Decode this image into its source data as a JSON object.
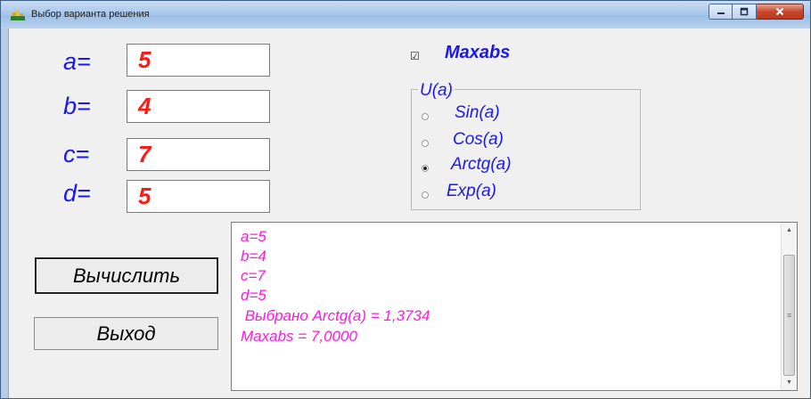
{
  "window": {
    "title": "Выбор варианта решения",
    "minimize_icon": "minimize-icon",
    "maximize_icon": "maximize-icon",
    "close_icon": "close-icon"
  },
  "inputs": [
    {
      "label": "a=",
      "value": "5"
    },
    {
      "label": "b=",
      "value": "4"
    },
    {
      "label": "c=",
      "value": "7"
    },
    {
      "label": "d=",
      "value": "5"
    }
  ],
  "maxabs": {
    "label": "Maxabs",
    "checked": true,
    "check_glyph": "☑"
  },
  "group": {
    "title": "U(a)",
    "options": [
      {
        "label": "Sin(a)",
        "selected": false
      },
      {
        "label": "Cos(a)",
        "selected": false
      },
      {
        "label": "Arctg(a)",
        "selected": true
      },
      {
        "label": "Exp(a)",
        "selected": false
      }
    ]
  },
  "buttons": {
    "compute": "Вычислить",
    "exit": "Выход"
  },
  "output": {
    "lines": [
      "a=5",
      "b=4",
      "c=7",
      "d=5",
      " Выбрано Arctg(a) = 1,3734",
      "Maxabs = 7,0000"
    ]
  },
  "colors": {
    "label_blue": "#1c16f0",
    "value_red": "#ff1a1a",
    "output_magenta": "#ff1ad9"
  }
}
